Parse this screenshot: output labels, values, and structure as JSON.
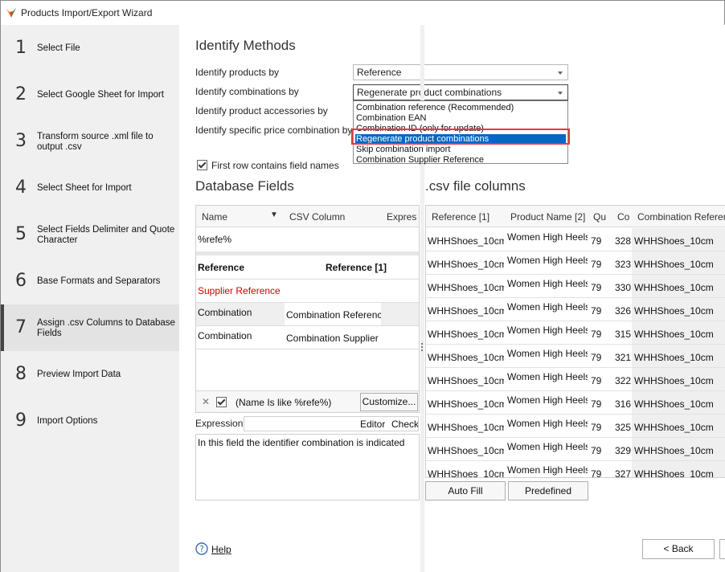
{
  "window": {
    "title": "Products Import/Export Wizard"
  },
  "steps": [
    {
      "num": "1",
      "label": "Select File"
    },
    {
      "num": "2",
      "label": "Select Google Sheet for Import"
    },
    {
      "num": "3",
      "label": "Transform source .xml file to output .csv"
    },
    {
      "num": "4",
      "label": "Select Sheet for Import"
    },
    {
      "num": "5",
      "label": "Select Fields Delimiter and Quote Character"
    },
    {
      "num": "6",
      "label": "Base Formats and Separators"
    },
    {
      "num": "7",
      "label": "Assign .csv Columns to Database Fields"
    },
    {
      "num": "8",
      "label": "Preview Import Data"
    },
    {
      "num": "9",
      "label": "Import Options"
    }
  ],
  "identify": {
    "heading": "Identify Methods",
    "products_label": "Identify products by",
    "products_value": "Reference",
    "combinations_label": "Identify combinations by",
    "combinations_value": "Regenerate product combinations",
    "accessories_label": "Identify product accessories by",
    "specific_price_label": "Identify specific price combination by",
    "dropdown_options": [
      "Combination reference (Recommended)",
      "Combination EAN",
      "Combination ID (only for update)",
      "Regenerate product combinations",
      "Skip combination import",
      "Combination Supplier Reference"
    ],
    "first_row_label": "First row contains field names"
  },
  "db": {
    "heading": "Database Fields",
    "col_name": "Name",
    "col_csv": "CSV Column",
    "col_expr": "Expres",
    "filter_value": "%refe%",
    "rows": [
      {
        "name": "Reference",
        "csv": "Reference [1]"
      },
      {
        "name": "Supplier Reference",
        "csv": ""
      },
      {
        "name": "Combination",
        "csv": "Combination Referenc"
      },
      {
        "name": "Combination",
        "csv": "Combination Supplier"
      }
    ],
    "filter_text": "(Name Is like %refe%)",
    "customize_label": "Customize...",
    "close_glyph": "✕",
    "expression_label": "Expression",
    "editor_label": "Editor",
    "check_label": "Check",
    "description": "In this field the identifier combination is indicated"
  },
  "csv": {
    "heading": ".csv file columns",
    "columns": [
      "Reference [1]",
      "Product Name [2]",
      "Qu",
      "Co",
      "Combination Referen"
    ],
    "rows": [
      [
        "WHHShoes_10cm",
        "Women High Heels",
        "79",
        "328",
        "WHHShoes_10cm"
      ],
      [
        "WHHShoes_10cm",
        "Women High Heels",
        "79",
        "323",
        "WHHShoes_10cm"
      ],
      [
        "WHHShoes_10cm",
        "Women High Heels",
        "79",
        "330",
        "WHHShoes_10cm"
      ],
      [
        "WHHShoes_10cm",
        "Women High Heels",
        "79",
        "326",
        "WHHShoes_10cm"
      ],
      [
        "WHHShoes_10cm",
        "Women High Heels",
        "79",
        "315",
        "WHHShoes_10cm"
      ],
      [
        "WHHShoes_10cm",
        "Women High Heels",
        "79",
        "321",
        "WHHShoes_10cm"
      ],
      [
        "WHHShoes_10cm",
        "Women High Heels",
        "79",
        "322",
        "WHHShoes_10cm"
      ],
      [
        "WHHShoes_10cm",
        "Women High Heels",
        "79",
        "316",
        "WHHShoes_10cm"
      ],
      [
        "WHHShoes_10cm",
        "Women High Heels",
        "79",
        "325",
        "WHHShoes_10cm"
      ],
      [
        "WHHShoes_10cm",
        "Women High Heels",
        "79",
        "329",
        "WHHShoes_10cm"
      ],
      [
        "WHHShoes_10cm",
        "Women High Heels",
        "79",
        "327",
        "WHHShoes_10cm"
      ]
    ],
    "autofill_label": "Auto Fill",
    "predefined_label": "Predefined"
  },
  "footer": {
    "help_label": "Help",
    "back_label": "< Back"
  },
  "colors": {
    "highlight_border": "#e23b3b",
    "selection": "#0a64c8",
    "supplier_text": "#d40000"
  }
}
